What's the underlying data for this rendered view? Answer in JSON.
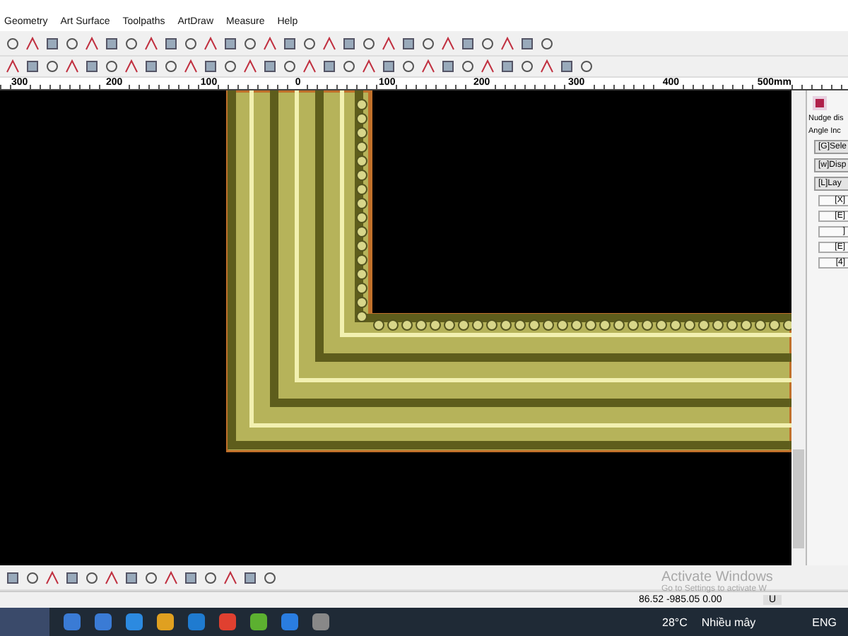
{
  "menu": [
    "Geometry",
    "Art Surface",
    "Toolpaths",
    "ArtDraw",
    "Measure",
    "Help"
  ],
  "ruler": [
    "300",
    "200",
    "100",
    "0",
    "100",
    "200",
    "300",
    "400",
    "500mm"
  ],
  "panel": {
    "labels": [
      "Nudge dis",
      "Angle Inc"
    ],
    "buttons": [
      "[G]Sele",
      "[w]Disp",
      "[L]Lay"
    ],
    "small_buttons": [
      "[X]",
      "[E]",
      "]",
      "[E]",
      "[4]"
    ]
  },
  "activation": {
    "title": "Activate Windows",
    "subtitle": "Go to Settings to activate W"
  },
  "status_bar": {
    "coordinates": "86.52 -985.05 0.00",
    "unit": "U"
  },
  "taskbar": {
    "temperature": "28°C",
    "weather": "Nhiều mây",
    "language": "ENG"
  }
}
